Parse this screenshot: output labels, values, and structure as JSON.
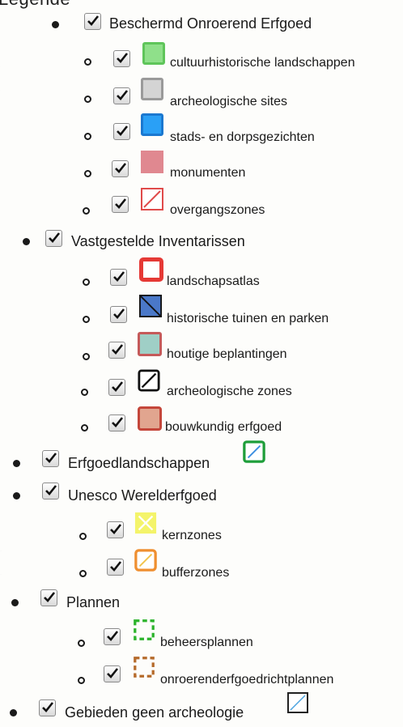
{
  "header": {
    "title": "Legende"
  },
  "colors": {
    "cultuurhistorische_landschappen": "#7fd87a",
    "archeologische_sites": "#c9c9c9",
    "stads_dorpsgezichten": "#1e90f0",
    "monumenten": "#e0808a",
    "overgangszones": "#e04a4a",
    "landschapsatlas": "#e53935",
    "historische_tuinen": "#4472c4",
    "houtige_beplantingen": "#8ec4b8",
    "bouwkundig_erfgoed": "#d48a73",
    "erfgoedlandschappen": "#1e9e3a",
    "kernzones": "#f2f25a",
    "bufferzones": "#ef8f30",
    "beheersplannen": "#2bb32b",
    "onroerenderfgoedrichtplannen": "#b56a2a"
  },
  "legend": [
    {
      "label": "Beschermd Onroerend Erfgoed",
      "checked": true,
      "children": [
        {
          "label": "cultuurhistorische landschappen",
          "checked": true,
          "icon": "green-filled-square"
        },
        {
          "label": "archeologische sites",
          "checked": true,
          "icon": "grey-filled-square"
        },
        {
          "label": "stads- en dorpsgezichten",
          "checked": true,
          "icon": "blue-filled-square"
        },
        {
          "label": "monumenten",
          "checked": true,
          "icon": "pink-filled-square"
        },
        {
          "label": "overgangszones",
          "checked": true,
          "icon": "red-hatched-square"
        }
      ]
    },
    {
      "label": "Vastgestelde Inventarissen",
      "checked": true,
      "children": [
        {
          "label": "landschapsatlas",
          "checked": true,
          "icon": "red-outline-square"
        },
        {
          "label": "historische tuinen en parken",
          "checked": true,
          "icon": "blue-hatched-square"
        },
        {
          "label": "houtige beplantingen",
          "checked": true,
          "icon": "teal-filled-square"
        },
        {
          "label": "archeologische zones",
          "checked": true,
          "icon": "black-hatched-square"
        },
        {
          "label": "bouwkundig erfgoed",
          "checked": true,
          "icon": "salmon-filled-square"
        }
      ]
    },
    {
      "label": "Erfgoedlandschappen",
      "checked": true,
      "icon": "green-hatched-square",
      "children": []
    },
    {
      "label": "Unesco Werelderfgoed",
      "checked": true,
      "children": [
        {
          "label": "kernzones",
          "checked": true,
          "icon": "yellow-cross-square"
        },
        {
          "label": "bufferzones",
          "checked": true,
          "icon": "orange-hatched-square"
        }
      ]
    },
    {
      "label": "Plannen",
      "checked": true,
      "children": [
        {
          "label": "beheersplannen",
          "checked": true,
          "icon": "green-dashed-square"
        },
        {
          "label": "onroerenderfgoedrichtplannen",
          "checked": true,
          "icon": "brown-dashed-square"
        }
      ]
    },
    {
      "label": "Gebieden geen archeologie",
      "checked": true,
      "icon": "blue-hatched-outline-square",
      "children": []
    }
  ]
}
